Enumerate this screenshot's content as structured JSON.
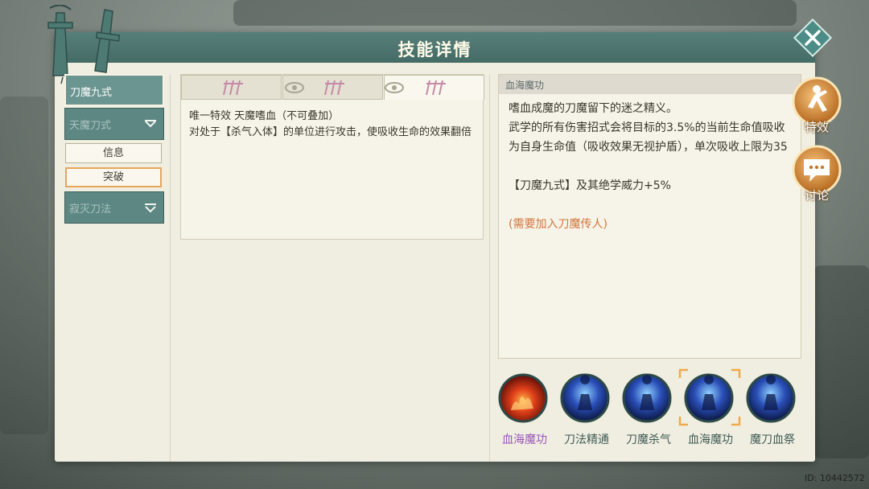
{
  "header": {
    "title": "技能详情"
  },
  "sidebar": {
    "tabs": [
      {
        "label": "刀魔九式",
        "state": "active"
      },
      {
        "label": "天魔刀式",
        "state": "dim"
      },
      {
        "label": "寂灭刀法",
        "state": "dim"
      }
    ],
    "subtabs": [
      {
        "label": "信息"
      },
      {
        "label": "突破"
      }
    ]
  },
  "tiers": {
    "count": 3,
    "active_index": 2,
    "description": [
      "唯一特效 天魔嗜血（不可叠加）",
      "对处于【杀气入体】的单位进行攻击，使吸收生命的效果翻倍"
    ]
  },
  "info": {
    "title": "血海魔功",
    "lines": [
      "嗜血成魔的刀魔留下的迷之精义。",
      "武学的所有伤害招式会将目标的3.5%的当前生命值吸收为自身生命值（吸收效果无视护盾），单次吸收上限为35",
      "",
      "【刀魔九式】及其绝学威力+5%",
      ""
    ],
    "requirement": "(需要加入刀魔传人)"
  },
  "skills": [
    {
      "name": "血海魔功",
      "icon": "fire-orb-icon",
      "selected": false
    },
    {
      "name": "刀法精通",
      "icon": "blue-figure-icon",
      "selected": false
    },
    {
      "name": "刀魔杀气",
      "icon": "blue-figure-icon",
      "selected": false
    },
    {
      "name": "血海魔功",
      "icon": "blue-figure-icon",
      "selected": true
    },
    {
      "name": "魔刀血祭",
      "icon": "blue-figure-icon",
      "selected": false
    }
  ],
  "side_buttons": [
    {
      "label": "特效",
      "icon": "martial-pose-icon"
    },
    {
      "label": "讨论",
      "icon": "chat-bubble-icon"
    }
  ],
  "footer": {
    "id_text": "ID: 10442572"
  },
  "colors": {
    "accent": "#e9a55b",
    "header": "#4f7873",
    "panel": "#f0eee0"
  }
}
